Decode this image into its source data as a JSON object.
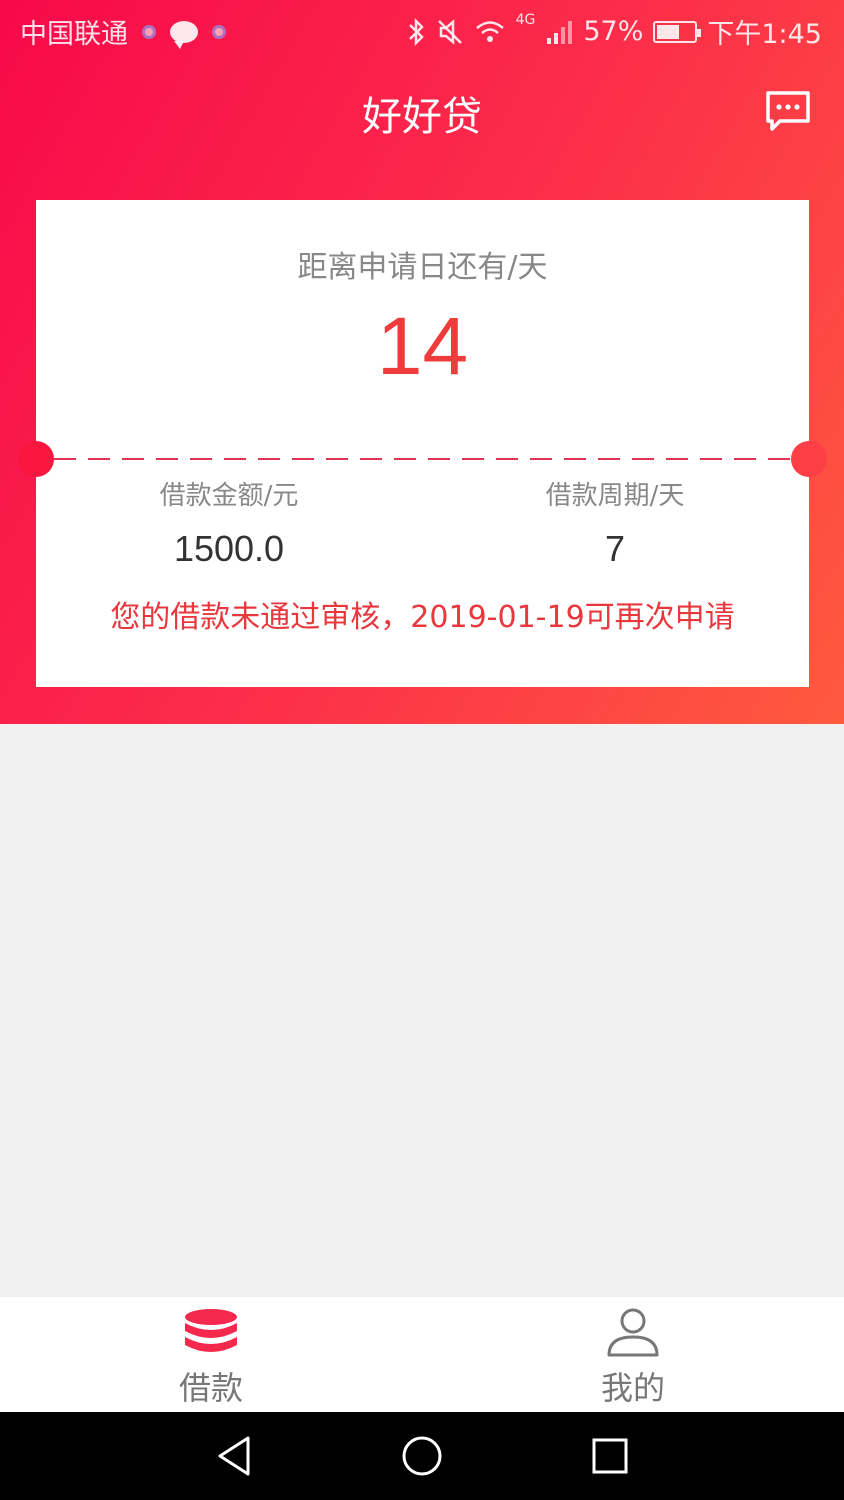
{
  "status": {
    "carrier": "中国联通",
    "network": "4G",
    "battery": "57%",
    "time": "下午1:45"
  },
  "header": {
    "title": "好好贷"
  },
  "card": {
    "countdown_label": "距离申请日还有/天",
    "countdown_value": "14",
    "amount_label": "借款金额/元",
    "amount_value": "1500.0",
    "period_label": "借款周期/天",
    "period_value": "7",
    "notice": "您的借款未通过审核，2019-01-19可再次申请"
  },
  "tabs": [
    {
      "label": "借款",
      "icon": "coins-icon",
      "active": true
    },
    {
      "label": "我的",
      "icon": "user-icon",
      "active": false
    }
  ],
  "colors": {
    "gradient_start": "#f7094a",
    "gradient_end": "#fe5a3e",
    "accent_red": "#ee3b3b",
    "tab_icon_active": "#f5294d"
  }
}
